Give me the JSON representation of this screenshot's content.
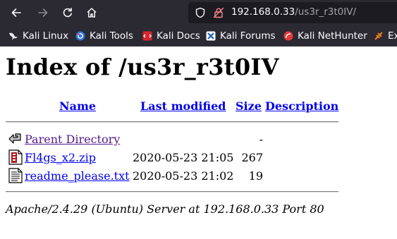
{
  "browser": {
    "url": {
      "host": "192.168.0.33",
      "path": "/us3r_r3t0IV/"
    },
    "bookmarks": [
      {
        "label": "Kali Linux",
        "icon": "kali-dragon-icon"
      },
      {
        "label": "Kali Tools",
        "icon": "kali-tools-icon"
      },
      {
        "label": "Kali Docs",
        "icon": "kali-docs-icon"
      },
      {
        "label": "Kali Forums",
        "icon": "kali-forums-icon"
      },
      {
        "label": "Kali NetHunter",
        "icon": "kali-nethunter-icon"
      },
      {
        "label": "Ex",
        "icon": "exploit-db-icon"
      }
    ]
  },
  "page": {
    "title": "Index of /us3r_r3t0IV",
    "columns": {
      "name": "Name",
      "last_modified": "Last modified",
      "size": "Size",
      "description": "Description"
    },
    "rows": [
      {
        "name": "Parent Directory",
        "last_modified": "",
        "size": "-",
        "description": "",
        "icon": "back-arrow-icon"
      },
      {
        "name": "Fl4gs_x2.zip",
        "last_modified": "2020-05-23 21:05",
        "size": "267",
        "description": "",
        "icon": "compressed-file-icon"
      },
      {
        "name": "readme_please.txt",
        "last_modified": "2020-05-23 21:02",
        "size": "19",
        "description": "",
        "icon": "text-file-icon"
      }
    ],
    "footer": "Apache/2.4.29 (Ubuntu) Server at 192.168.0.33 Port 80"
  },
  "colors": {
    "toolbar": "#2b2a33",
    "urlbar": "#1c1b22",
    "link": "#0000ee",
    "visited_link": "#551a8b"
  }
}
